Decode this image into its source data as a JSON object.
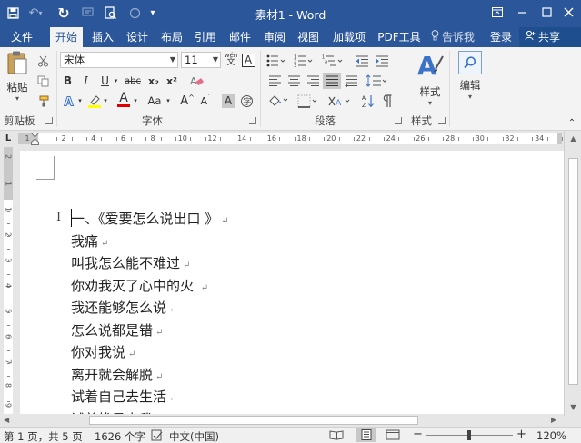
{
  "titlebar": {
    "title": "素材1 - Word",
    "qa_more": "▾"
  },
  "tabs": [
    "文件",
    "开始",
    "插入",
    "设计",
    "布局",
    "引用",
    "邮件",
    "审阅",
    "视图",
    "加载项",
    "PDF工具"
  ],
  "tell_me": "告诉我",
  "login": "登录",
  "share": "共享",
  "ribbon": {
    "clipboard": {
      "paste": "粘贴",
      "label": "剪贴板"
    },
    "font": {
      "font_name": "宋体",
      "font_size": "11",
      "wen": "wén",
      "bold": "B",
      "italic": "I",
      "underline": "U",
      "strike": "abc",
      "sub": "x₂",
      "sup": "x²",
      "font_color": "A",
      "aa": "Aa",
      "grow": "A",
      "shrink": "A",
      "shade": "A",
      "boxA": "A",
      "label": "字体"
    },
    "paragraph": {
      "label": "段落"
    },
    "styles": {
      "btn": "样式",
      "label": "样式"
    },
    "editing": {
      "btn": "编辑"
    }
  },
  "ruler": {
    "numbers": [
      "2",
      "4",
      "6",
      "8",
      "10",
      "12",
      "14",
      "16",
      "18",
      "20",
      "22",
      "24",
      "26",
      "28",
      "30",
      "32",
      "34"
    ],
    "left_num": "1",
    "vnumbers": [
      "2",
      "1",
      "1",
      "2",
      "3",
      "4",
      "5",
      "6",
      "7",
      "8",
      "9"
    ]
  },
  "document": {
    "lines": [
      "一、《爱要怎么说出口 》",
      "我痛",
      "叫我怎么能不难过",
      "你劝我灭了心中的火 ",
      "我还能够怎么说",
      "怎么说都是错",
      "你对我说",
      "离开就会解脱",
      "试着自己去生活",
      "试着找寻自我"
    ],
    "para_mark": "↵"
  },
  "status": {
    "page": "第 1 页，共 5 页",
    "words": "1626 个字",
    "lang": "中文(中国)",
    "zoom": "120%"
  },
  "colors": {
    "accent": "#2b579a",
    "highlight": "#ffff00",
    "font_color_bar": "#e00000"
  }
}
